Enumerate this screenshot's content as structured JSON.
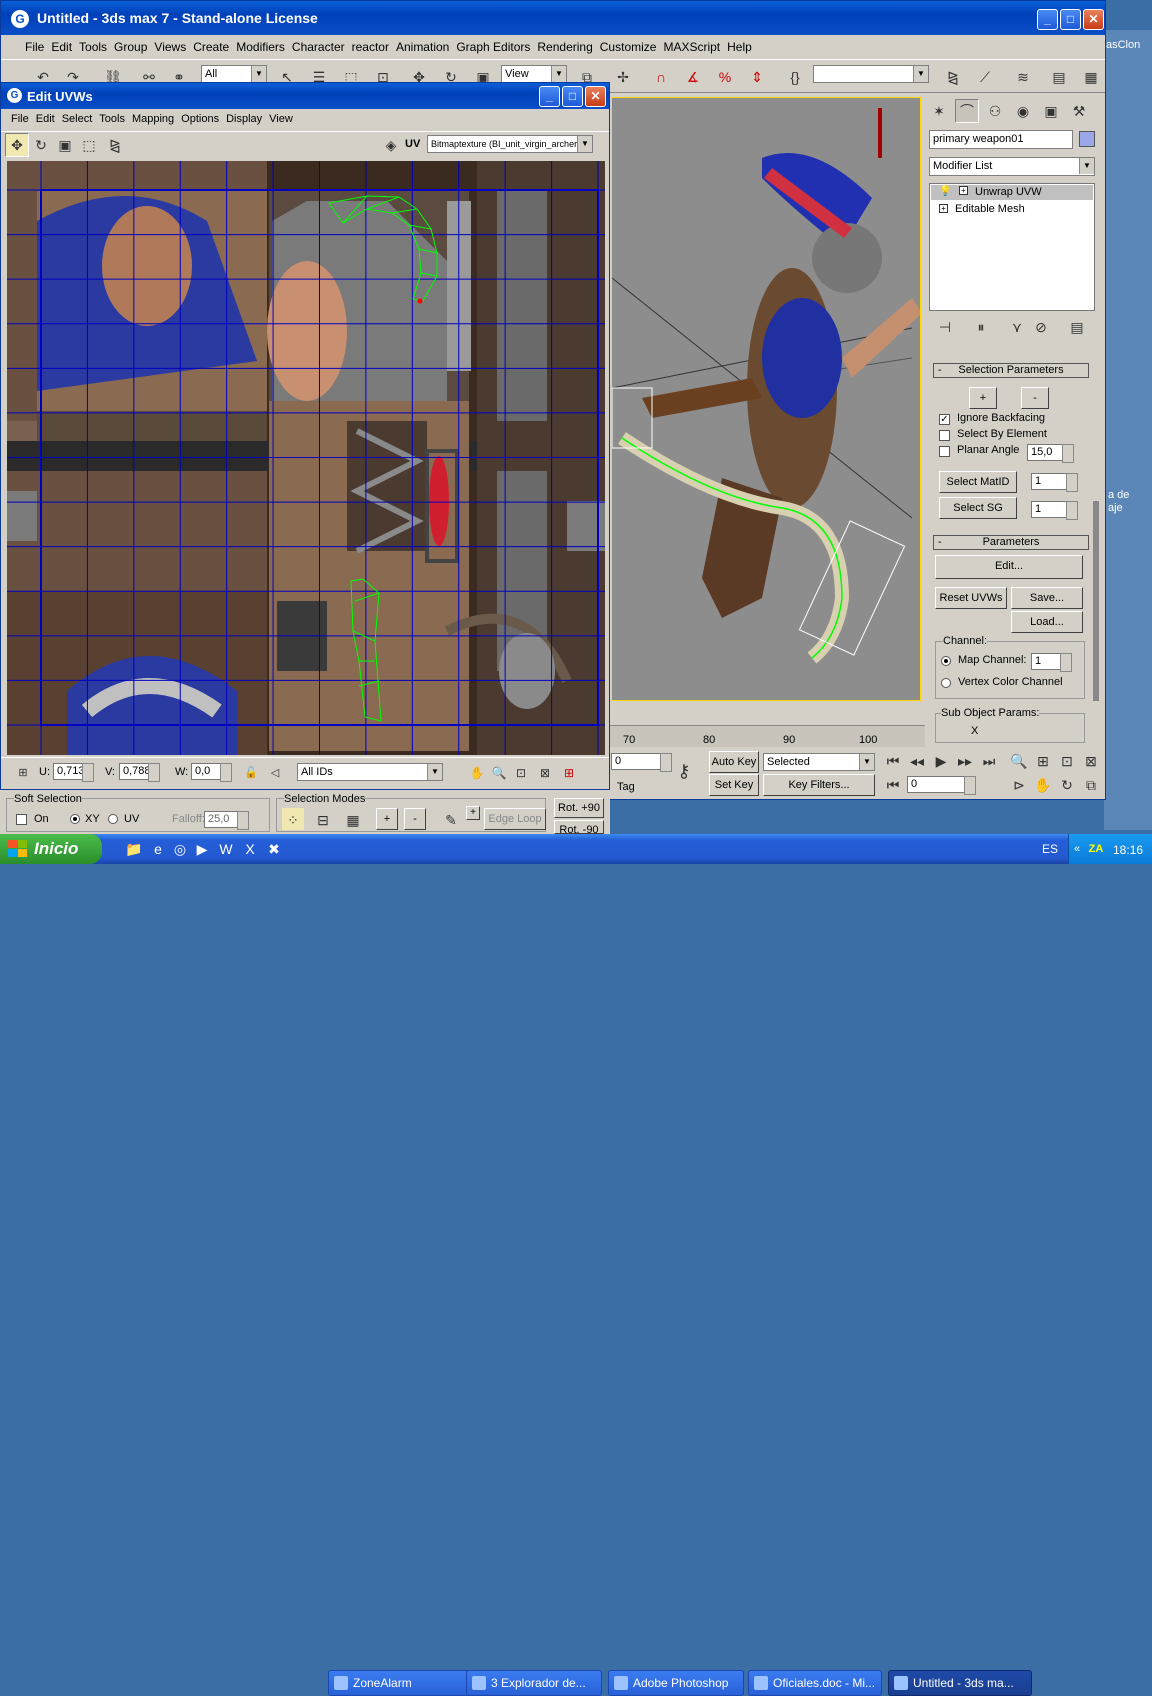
{
  "main_window": {
    "title": "Untitled - 3ds max 7  - Stand-alone License",
    "menu": [
      "File",
      "Edit",
      "Tools",
      "Group",
      "Views",
      "Create",
      "Modifiers",
      "Character",
      "reactor",
      "Animation",
      "Graph Editors",
      "Rendering",
      "Customize",
      "MAXScript",
      "Help"
    ],
    "selection_filter": "All",
    "ref_coord": "View"
  },
  "uvw_window": {
    "title": "Edit UVWs",
    "menu": [
      "File",
      "Edit",
      "Select",
      "Tools",
      "Mapping",
      "Options",
      "Display",
      "View"
    ],
    "uv_label": "UV",
    "texture_select": "Bitmaptexture (BI_unit_virgin_archers_",
    "status": {
      "u_label": "U:",
      "u_value": "0,713",
      "v_label": "V:",
      "v_value": "0,788",
      "w_label": "W:",
      "w_value": "0,0",
      "ids": "All IDs"
    }
  },
  "command_panel": {
    "object_name": "primary weapon01",
    "modifier_list": "Modifier List",
    "stack": [
      "Unwrap UVW",
      "Editable Mesh"
    ],
    "selection_parameters": {
      "header": "Selection Parameters",
      "plus": "+",
      "minus": "-",
      "ignore_backfacing": "Ignore Backfacing",
      "select_by_element": "Select By Element",
      "planar_angle": "Planar Angle",
      "planar_angle_value": "15,0",
      "select_matid": "Select MatID",
      "matid_value": "1",
      "select_sg": "Select SG",
      "sg_value": "1"
    },
    "parameters": {
      "header": "Parameters",
      "edit": "Edit...",
      "reset": "Reset UVWs",
      "save": "Save...",
      "load": "Load...",
      "channel_label": "Channel:",
      "map_channel": "Map Channel:",
      "map_channel_value": "1",
      "vertex_color": "Vertex Color Channel",
      "sub_object": "Sub Object Params:",
      "x_label": "X"
    }
  },
  "timeline": {
    "ticks": [
      "70",
      "80",
      "90",
      "100"
    ],
    "auto_key": "Auto Key",
    "set_key": "Set Key",
    "selected": "Selected",
    "key_filters": "Key Filters...",
    "frame": "0",
    "tag": "Tag",
    "left_value": "0"
  },
  "bottom_panel": {
    "soft_selection": "Soft Selection",
    "on": "On",
    "xy": "XY",
    "uv": "UV",
    "falloff": "Falloff:",
    "falloff_value": "25,0",
    "selection_modes": "Selection Modes",
    "edge_loop": "Edge Loop",
    "rot90": "Rot. +90",
    "rot_minus": "Rot. -90"
  },
  "desktop": {
    "label1": "asClon",
    "label2a": "a de",
    "label2b": "aje"
  },
  "taskbar": {
    "start": "Inicio",
    "tasks": [
      "ZoneAlarm",
      "3 Explorador de...",
      "Adobe Photoshop",
      "Oficiales.doc - Mi...",
      "Untitled - 3ds ma..."
    ],
    "lang": "ES",
    "clock": "18:16"
  },
  "colors": {
    "xp_blue": "#0a4fc8",
    "panel": "#d4d0c8",
    "uv_grid": "#0000c0",
    "selected_uv": "#00ff00",
    "viewport": "#8c8c8c",
    "task_green": "#3b9c3b"
  }
}
